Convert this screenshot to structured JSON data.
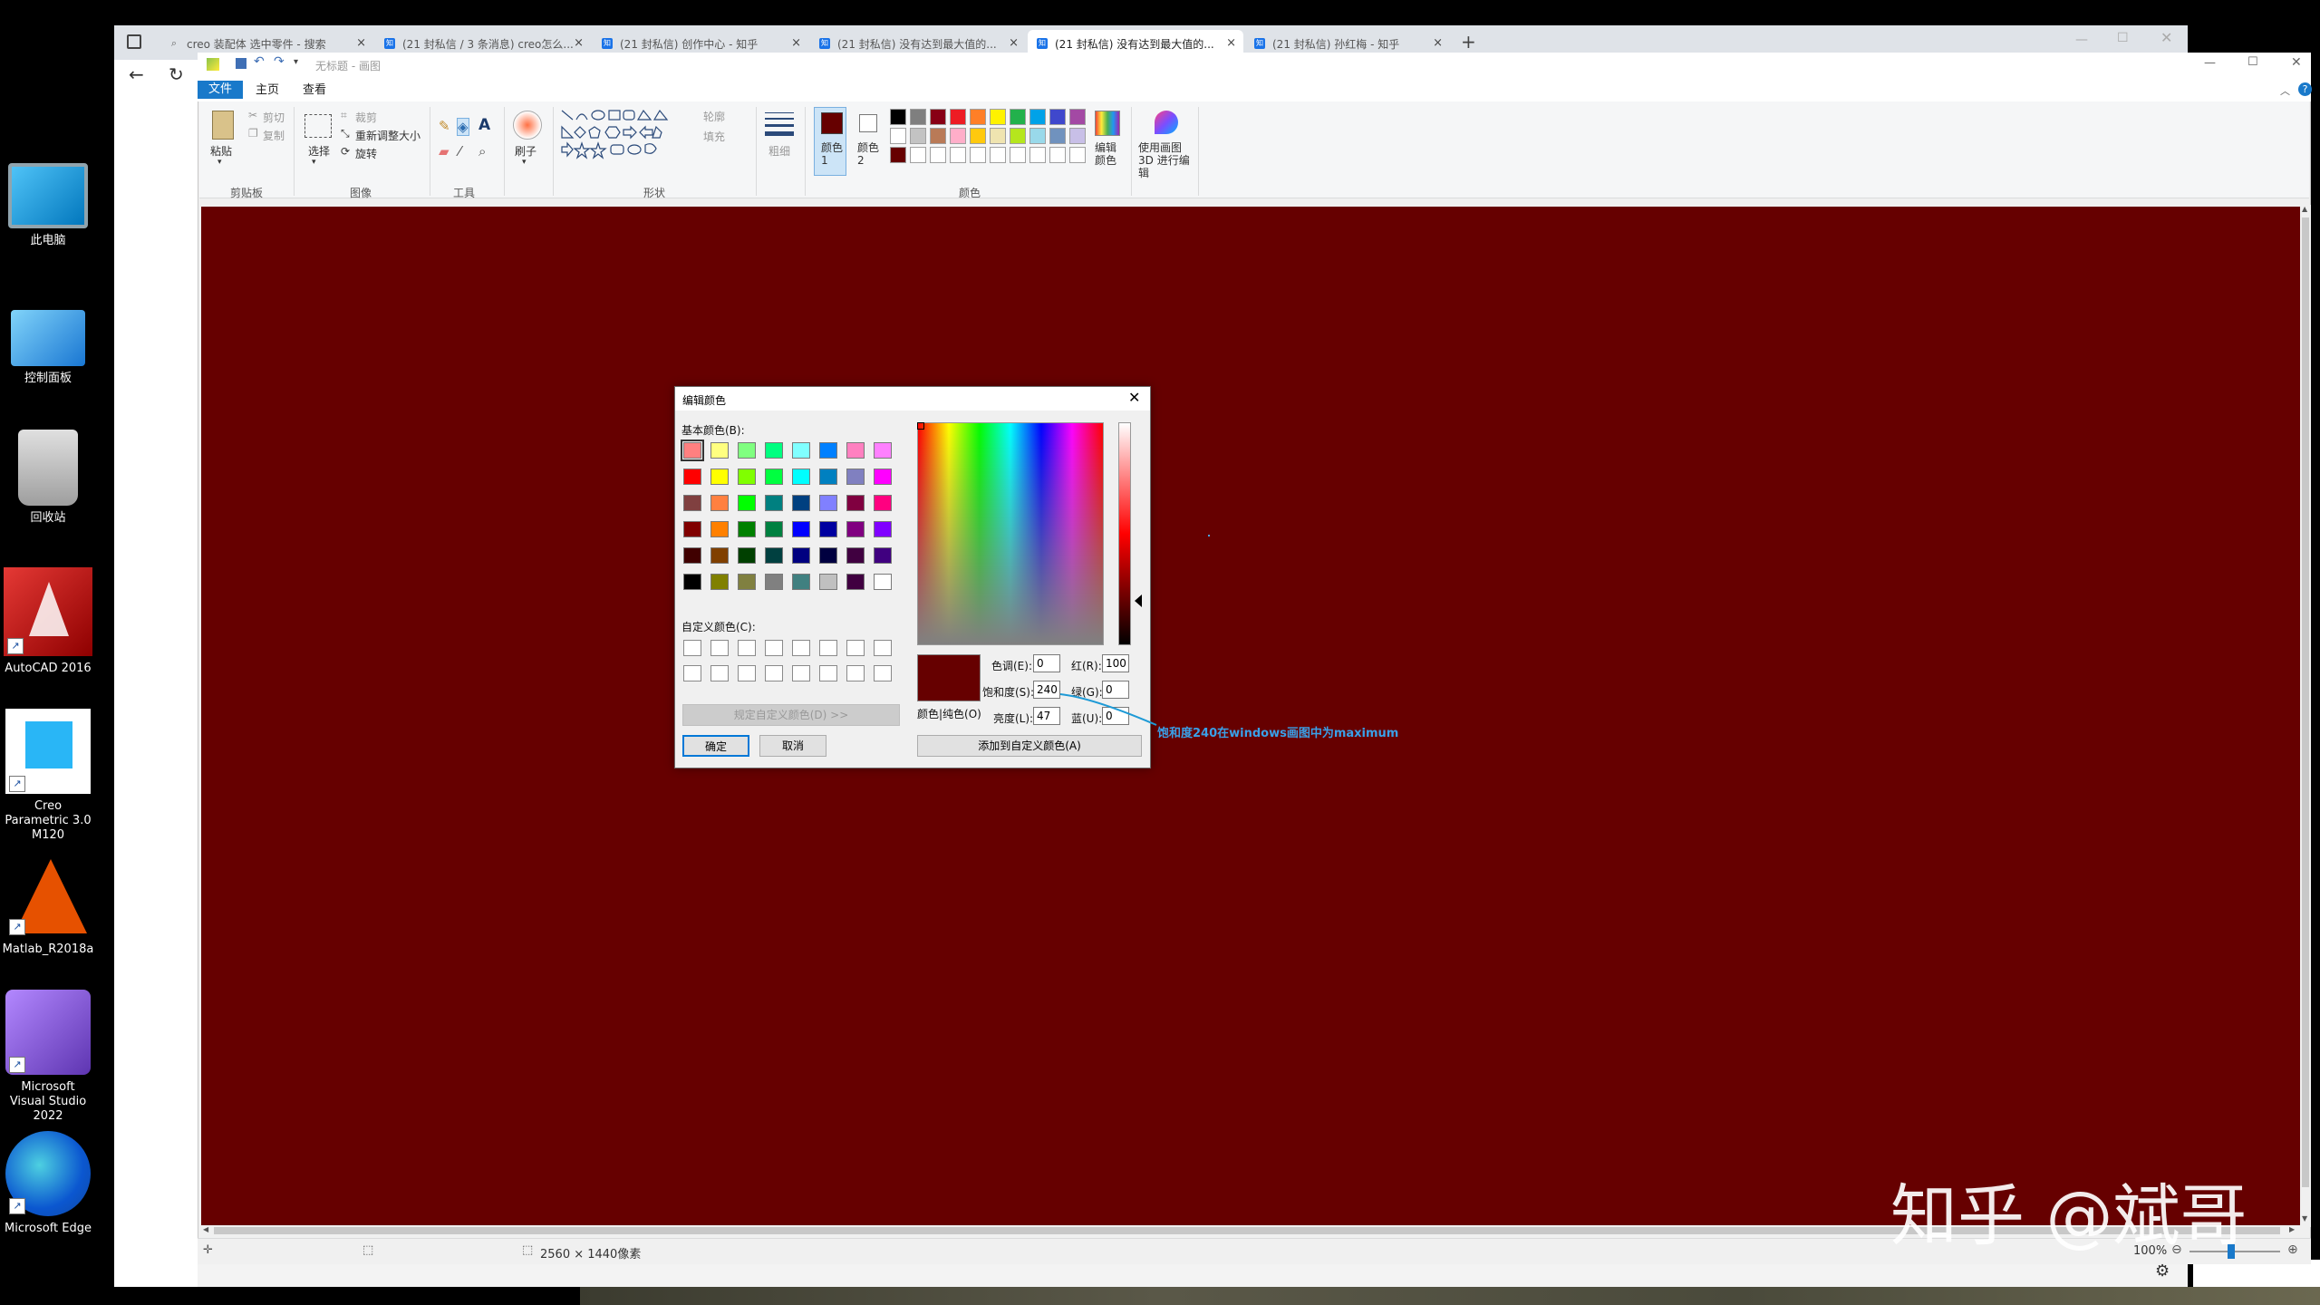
{
  "desktop": {
    "icons": [
      {
        "label": "此电脑"
      },
      {
        "label": "控制面板"
      },
      {
        "label": "回收站"
      },
      {
        "label": "AutoCAD 2016"
      },
      {
        "label": "Creo Parametric 3.0 M120"
      },
      {
        "label": "Matlab_R2018a"
      },
      {
        "label": "Microsoft Visual Studio 2022"
      },
      {
        "label": "Microsoft Edge"
      }
    ]
  },
  "browser": {
    "tabs": [
      {
        "label": "creo 装配体 选中零件 - 搜索"
      },
      {
        "label": "(21 封私信 / 3 条消息) creo怎么..."
      },
      {
        "label": "(21 封私信) 创作中心 - 知乎"
      },
      {
        "label": "(21 封私信) 没有达到最大值的..."
      },
      {
        "label": "(21 封私信) 没有达到最大值的..."
      },
      {
        "label": "(21 封私信) 孙红梅 - 知乎"
      }
    ],
    "new_tab": "+"
  },
  "paint": {
    "title": "无标题 - 画图",
    "menu": {
      "file": "文件",
      "home": "主页",
      "view": "查看"
    },
    "ribbon": {
      "clipboard": {
        "paste": "粘贴",
        "cut": "剪切",
        "copy": "复制",
        "label": "剪贴板"
      },
      "image": {
        "select": "选择",
        "crop": "裁剪",
        "resize": "重新调整大小",
        "rotate": "旋转",
        "label": "图像"
      },
      "tools": {
        "label": "工具"
      },
      "brushes": {
        "label": "刷子"
      },
      "shapes": {
        "outline": "轮廓",
        "fill": "填充",
        "label": "形状"
      },
      "size": {
        "label": "粗细"
      },
      "colors": {
        "color1": "颜色 1",
        "color2": "颜色 2",
        "edit": "编辑颜色",
        "label": "颜色"
      },
      "paint3d": "使用画图 3D 进行编辑"
    },
    "canvas_color": "#660000",
    "status": {
      "size": "2560 × 1440像素",
      "zoom": "100%"
    },
    "palette": [
      "#000000",
      "#7f7f7f",
      "#880015",
      "#ed1c24",
      "#ff7f27",
      "#fff200",
      "#22b14c",
      "#00a2e8",
      "#3f48cc",
      "#a349a4",
      "#ffffff",
      "#c3c3c3",
      "#b97a57",
      "#ffaec9",
      "#ffc90e",
      "#efe4b0",
      "#b5e61d",
      "#99d9ea",
      "#7092be",
      "#c8bfe7",
      "#660000",
      "#ffffff",
      "#ffffff",
      "#ffffff",
      "#ffffff",
      "#ffffff",
      "#ffffff",
      "#ffffff",
      "#ffffff",
      "#ffffff"
    ]
  },
  "dialog": {
    "title": "编辑颜色",
    "basic_label": "基本颜色(B):",
    "custom_label": "自定义颜色(C):",
    "define_btn": "规定自定义颜色(D) >>",
    "ok": "确定",
    "cancel": "取消",
    "solid_label": "颜色|纯色(O)",
    "add_custom": "添加到自定义颜色(A)",
    "fields": {
      "hue_label": "色调(E):",
      "hue": "0",
      "sat_label": "饱和度(S):",
      "sat": "240",
      "lum_label": "亮度(L):",
      "lum": "47",
      "red_label": "红(R):",
      "red": "100",
      "green_label": "绿(G):",
      "green": "0",
      "blue_label": "蓝(U):",
      "blue": "0"
    },
    "preview_color": "#660000",
    "basic_colors": [
      "#ff8080",
      "#ffff80",
      "#80ff80",
      "#00ff80",
      "#80ffff",
      "#0080ff",
      "#ff80c0",
      "#ff80ff",
      "#ff0000",
      "#ffff00",
      "#80ff00",
      "#00ff40",
      "#00ffff",
      "#0080c0",
      "#8080c0",
      "#ff00ff",
      "#804040",
      "#ff8040",
      "#00ff00",
      "#008080",
      "#004080",
      "#8080ff",
      "#800040",
      "#ff0080",
      "#800000",
      "#ff8000",
      "#008000",
      "#008040",
      "#0000ff",
      "#0000a0",
      "#800080",
      "#8000ff",
      "#400000",
      "#804000",
      "#004000",
      "#004040",
      "#000080",
      "#000040",
      "#400040",
      "#400080",
      "#000000",
      "#808000",
      "#808040",
      "#808080",
      "#408080",
      "#c0c0c0",
      "#400040",
      "#ffffff"
    ]
  },
  "annotation": "饱和度240在windows画图中为maximum",
  "watermark": "知乎 @斌哥"
}
